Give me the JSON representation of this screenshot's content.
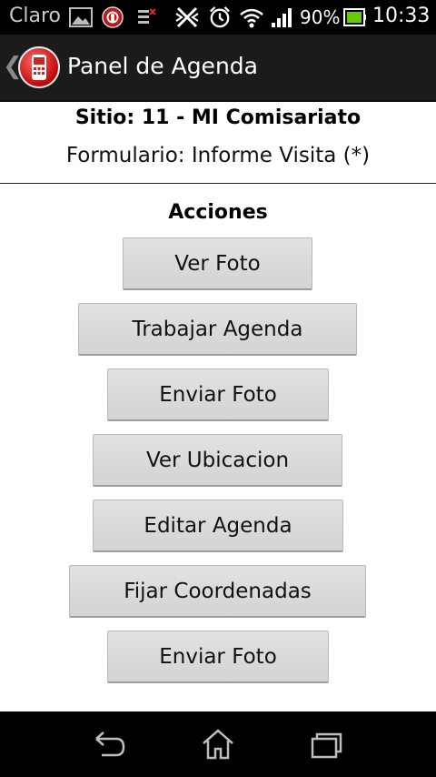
{
  "status_bar": {
    "carrier": "Claro",
    "battery_percent": "90%",
    "time": "10:33"
  },
  "action_bar": {
    "title": "Panel de Agenda"
  },
  "header": {
    "site": "Sitio: 11 - MI Comisariato",
    "form": "Formulario: Informe Visita (*)"
  },
  "actions": {
    "heading": "Acciones",
    "buttons": [
      "Ver Foto",
      "Trabajar Agenda",
      "Enviar Foto",
      "Ver Ubicacion",
      "Editar Agenda",
      "Fijar Coordenadas",
      "Enviar Foto"
    ]
  },
  "colors": {
    "action_bar": "#1b1b1b",
    "button": "#d9d9d9",
    "battery": "#66cc00"
  }
}
